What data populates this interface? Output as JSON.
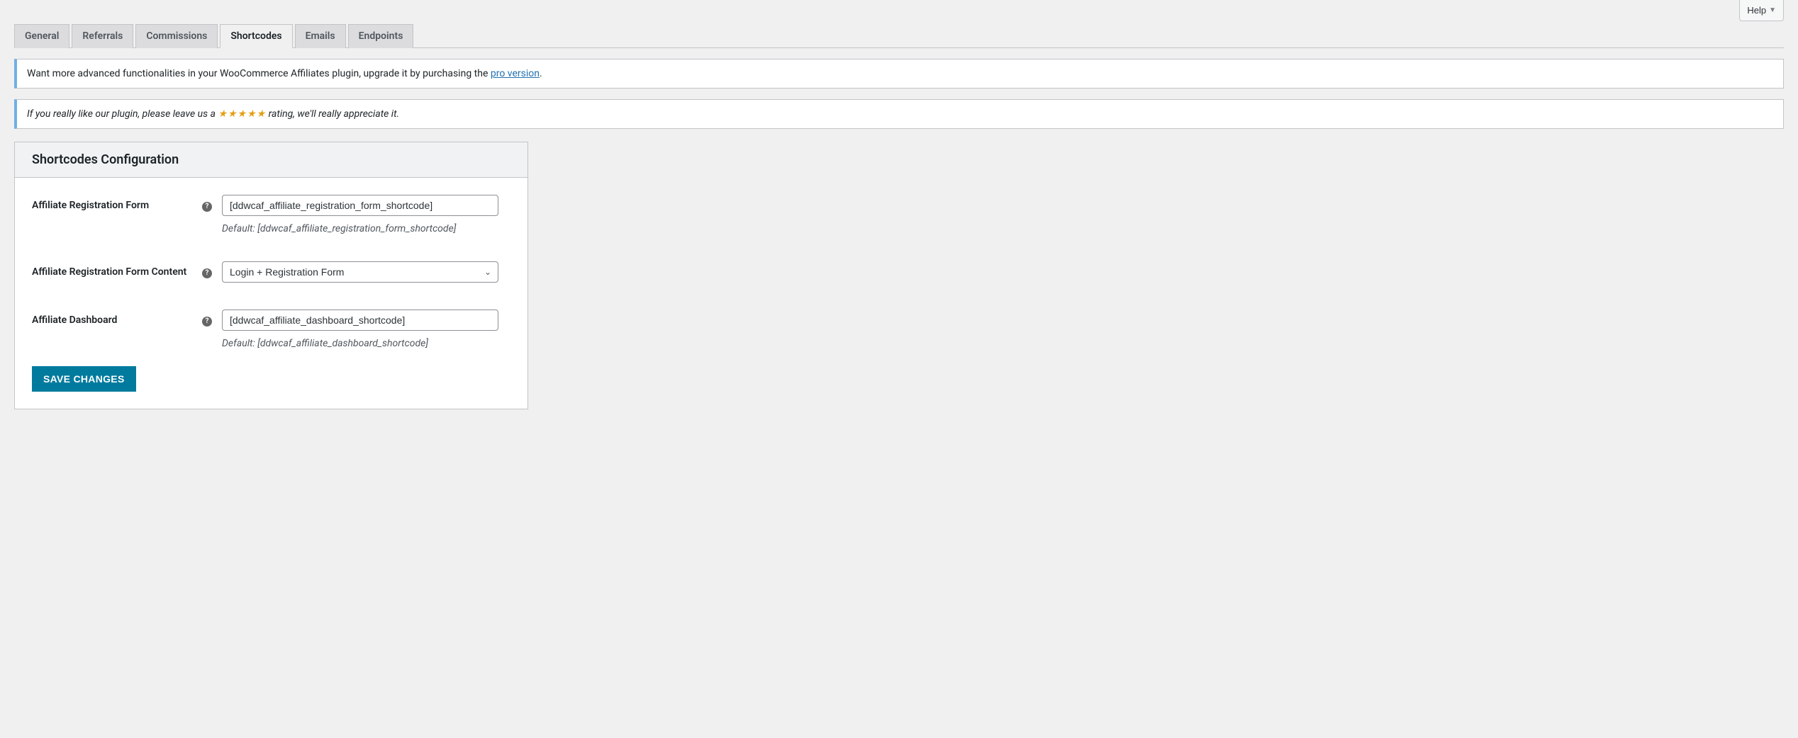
{
  "help_label": "Help",
  "tabs": {
    "general": "General",
    "referrals": "Referrals",
    "commissions": "Commissions",
    "shortcodes": "Shortcodes",
    "emails": "Emails",
    "endpoints": "Endpoints",
    "active": "shortcodes"
  },
  "notices": {
    "upgrade_pre": "Want more advanced functionalities in your WooCommerce Affiliates plugin, upgrade it by purchasing the",
    "upgrade_link": "pro version",
    "upgrade_post": ".",
    "rating_pre": "If you really like our plugin, please leave us a",
    "stars": "★★★★★",
    "rating_post": "rating, we'll really appreciate it."
  },
  "panel": {
    "title": "Shortcodes Configuration",
    "fields": {
      "reg_form": {
        "label": "Affiliate Registration Form",
        "value": "[ddwcaf_affiliate_registration_form_shortcode]",
        "default": "Default: [ddwcaf_affiliate_registration_form_shortcode]"
      },
      "reg_form_content": {
        "label": "Affiliate Registration Form Content",
        "selected": "Login + Registration Form"
      },
      "dashboard": {
        "label": "Affiliate Dashboard",
        "value": "[ddwcaf_affiliate_dashboard_shortcode]",
        "default": "Default: [ddwcaf_affiliate_dashboard_shortcode]"
      }
    },
    "save_label": "Save Changes"
  }
}
